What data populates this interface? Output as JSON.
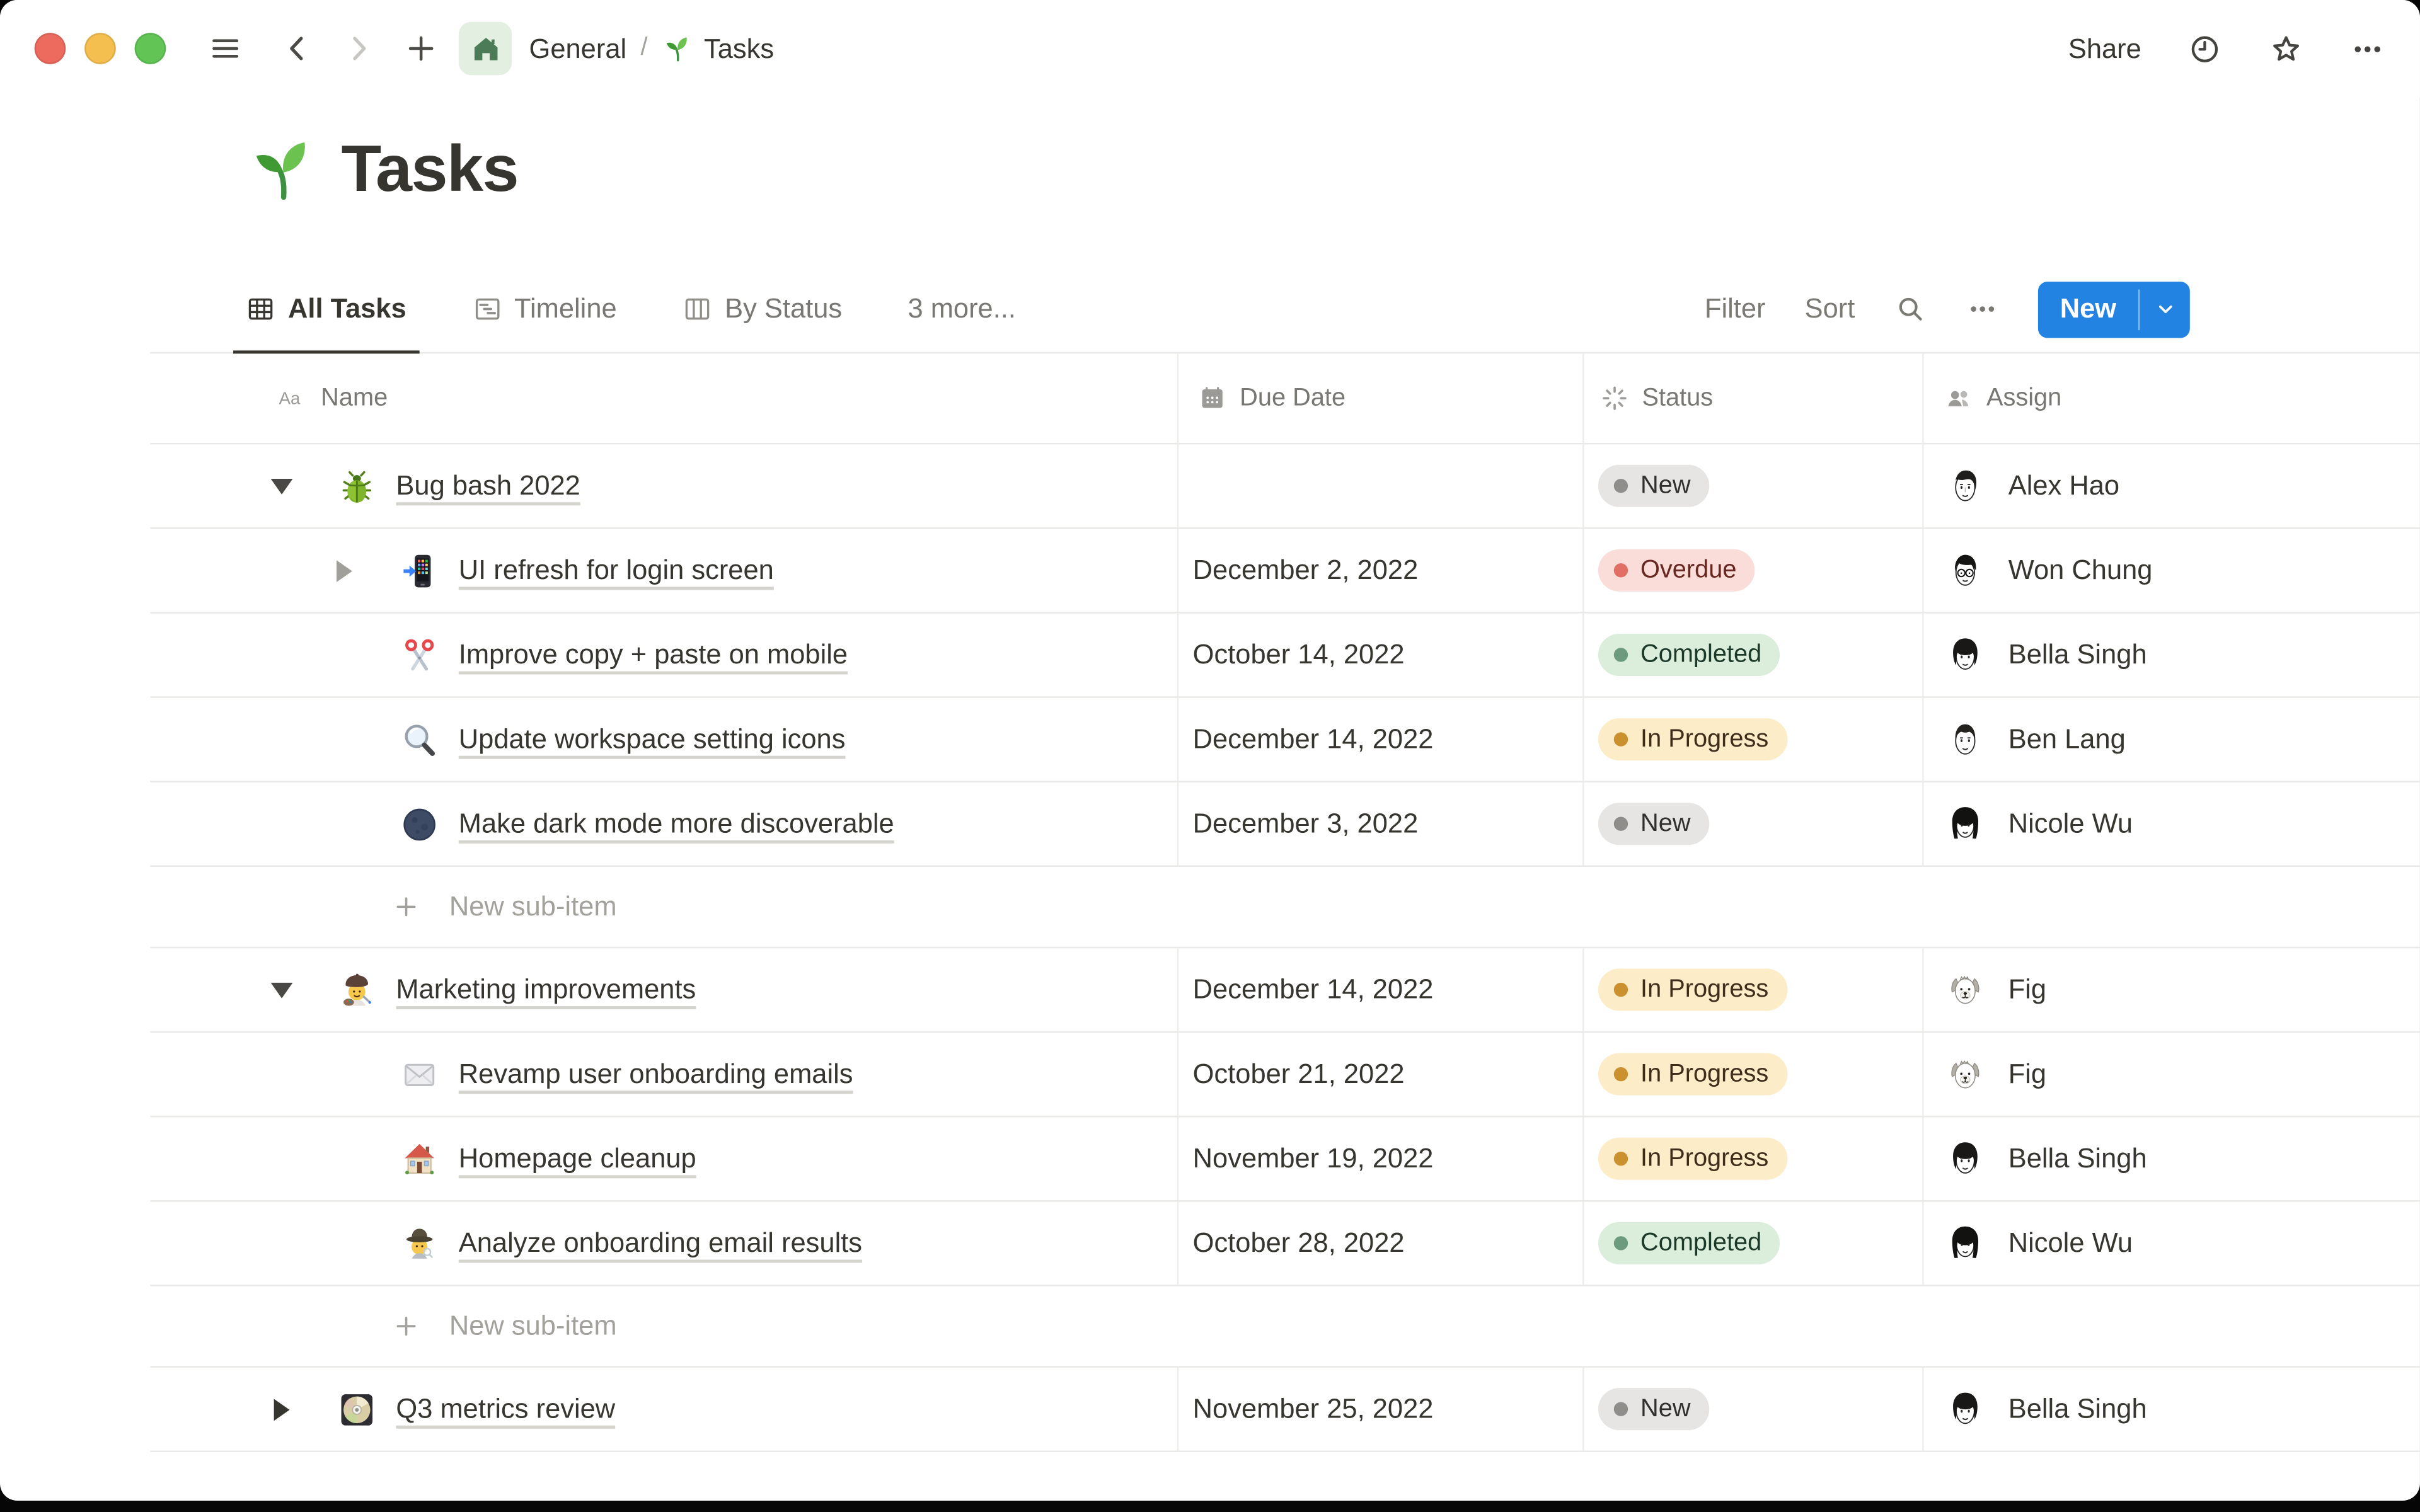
{
  "titlebar": {
    "traffic_lights": {
      "close": "#ec6a5e",
      "minimize": "#f5bf4f",
      "zoom": "#61c455"
    },
    "breadcrumb": {
      "workspace": "General",
      "divider": "/",
      "page_icon": "seedling",
      "page": "Tasks"
    },
    "share_label": "Share",
    "icons": [
      "hamburger-menu",
      "chevron-back",
      "chevron-forward",
      "plus",
      "home",
      "clock-history",
      "star-favorite",
      "ellipsis-more"
    ]
  },
  "page": {
    "icon": "seedling",
    "title": "Tasks"
  },
  "view_bar": {
    "tabs": [
      {
        "label": "All Tasks",
        "icon": "table-view",
        "active": true
      },
      {
        "label": "Timeline",
        "icon": "timeline-view",
        "active": false
      },
      {
        "label": "By Status",
        "icon": "board-view",
        "active": false
      },
      {
        "label": "3 more...",
        "icon": null,
        "active": false
      }
    ],
    "filter_label": "Filter",
    "sort_label": "Sort",
    "icons": [
      "search",
      "ellipsis-more"
    ],
    "new_button_label": "New"
  },
  "table": {
    "columns": [
      {
        "label": "Name",
        "icon": "text-type"
      },
      {
        "label": "Due Date",
        "icon": "calendar"
      },
      {
        "label": "Status",
        "icon": "status-burst"
      },
      {
        "label": "Assign",
        "icon": "people"
      }
    ],
    "new_sub_item_label": "New sub-item",
    "status_styles": {
      "gray": {
        "bg": "#e6e5e3",
        "dot": "#8f8e8b",
        "text": "#32302c"
      },
      "red": {
        "bg": "#fadcd9",
        "dot": "#e16f64",
        "text": "#67261f"
      },
      "green": {
        "bg": "#dbeddb",
        "dot": "#6c9b7d",
        "text": "#1c3829"
      },
      "yellow": {
        "bg": "#fdecc8",
        "dot": "#cb912f",
        "text": "#402c1b"
      }
    },
    "rows": [
      {
        "type": "item",
        "level": 0,
        "toggle": "expanded",
        "icon": "beetle",
        "title": "Bug bash 2022",
        "due": "",
        "status": "New",
        "status_color": "gray",
        "assignee": "Alex Hao",
        "avatar": "alex-hao"
      },
      {
        "type": "item",
        "level": 1,
        "toggle": "collapsed",
        "icon": "phone-arrow",
        "title": "UI refresh for login screen",
        "due": "December 2, 2022",
        "status": "Overdue",
        "status_color": "red",
        "assignee": "Won Chung",
        "avatar": "won-chung"
      },
      {
        "type": "item",
        "level": 1,
        "toggle": "none",
        "icon": "scissors",
        "title": "Improve copy + paste on mobile",
        "due": "October 14, 2022",
        "status": "Completed",
        "status_color": "green",
        "assignee": "Bella Singh",
        "avatar": "bella-singh"
      },
      {
        "type": "item",
        "level": 1,
        "toggle": "none",
        "icon": "magnifier",
        "title": "Update workspace setting icons",
        "due": "December 14, 2022",
        "status": "In Progress",
        "status_color": "yellow",
        "assignee": "Ben Lang",
        "avatar": "ben-lang"
      },
      {
        "type": "item",
        "level": 1,
        "toggle": "none",
        "icon": "new-moon",
        "title": "Make dark mode more discoverable",
        "due": "December 3, 2022",
        "status": "New",
        "status_color": "gray",
        "assignee": "Nicole Wu",
        "avatar": "nicole-wu"
      },
      {
        "type": "new-sub-item"
      },
      {
        "type": "item",
        "level": 0,
        "toggle": "expanded",
        "icon": "artist",
        "title": "Marketing improvements",
        "due": "December 14, 2022",
        "status": "In Progress",
        "status_color": "yellow",
        "assignee": "Fig",
        "avatar": "fig"
      },
      {
        "type": "item",
        "level": 1,
        "toggle": "none",
        "icon": "envelope",
        "title": "Revamp user onboarding emails",
        "due": "October 21, 2022",
        "status": "In Progress",
        "status_color": "yellow",
        "assignee": "Fig",
        "avatar": "fig"
      },
      {
        "type": "item",
        "level": 1,
        "toggle": "none",
        "icon": "house",
        "title": "Homepage cleanup",
        "due": "November 19, 2022",
        "status": "In Progress",
        "status_color": "yellow",
        "assignee": "Bella Singh",
        "avatar": "bella-singh"
      },
      {
        "type": "item",
        "level": 1,
        "toggle": "none",
        "icon": "detective",
        "title": "Analyze onboarding email results",
        "due": "October 28, 2022",
        "status": "Completed",
        "status_color": "green",
        "assignee": "Nicole Wu",
        "avatar": "nicole-wu"
      },
      {
        "type": "new-sub-item"
      },
      {
        "type": "item",
        "level": 0,
        "toggle": "collapsed",
        "icon": "dvd",
        "title": "Q3 metrics review",
        "due": "November 25, 2022",
        "status": "New",
        "status_color": "gray",
        "assignee": "Bella Singh",
        "avatar": "bella-singh"
      }
    ]
  },
  "colors": {
    "accent_blue": "#2383e2",
    "text_primary": "#37352f",
    "text_secondary": "#787774",
    "row_border": "#e9e9e7"
  }
}
